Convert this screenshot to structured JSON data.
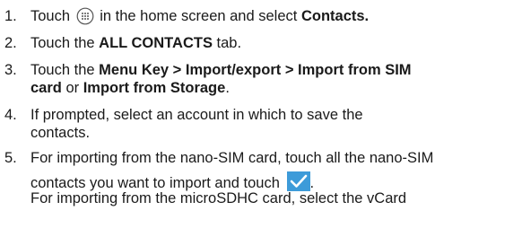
{
  "steps": [
    {
      "number": "1.",
      "pre": "Touch",
      "icon": "apps-icon",
      "mid": "in the home screen and select",
      "bold": "Contacts."
    },
    {
      "number": "2.",
      "pre": "Touch the",
      "bold": "ALL CONTACTS",
      "post": "tab."
    },
    {
      "number": "3.",
      "line1_pre": "Touch the",
      "line1_bold": "Menu Key > Import/export > Import from SIM",
      "line2_bold1": "card",
      "line2_mid": "or",
      "line2_bold2": "Import from Storage",
      "line2_post": "."
    },
    {
      "number": "4.",
      "line1": "If prompted, select an account in which to save the",
      "line2": "contacts."
    },
    {
      "number": "5.",
      "line1": "For importing from the nano-SIM card, touch all the nano-SIM",
      "line2": "contacts you want to import and touch",
      "line2_icon": "checkmark-icon",
      "line2_post": ".",
      "line3": "For importing from the microSDHC card, select the vCard"
    }
  ],
  "colors": {
    "text": "#1a1a1a",
    "check_icon_bg": "#3d9bd9"
  }
}
